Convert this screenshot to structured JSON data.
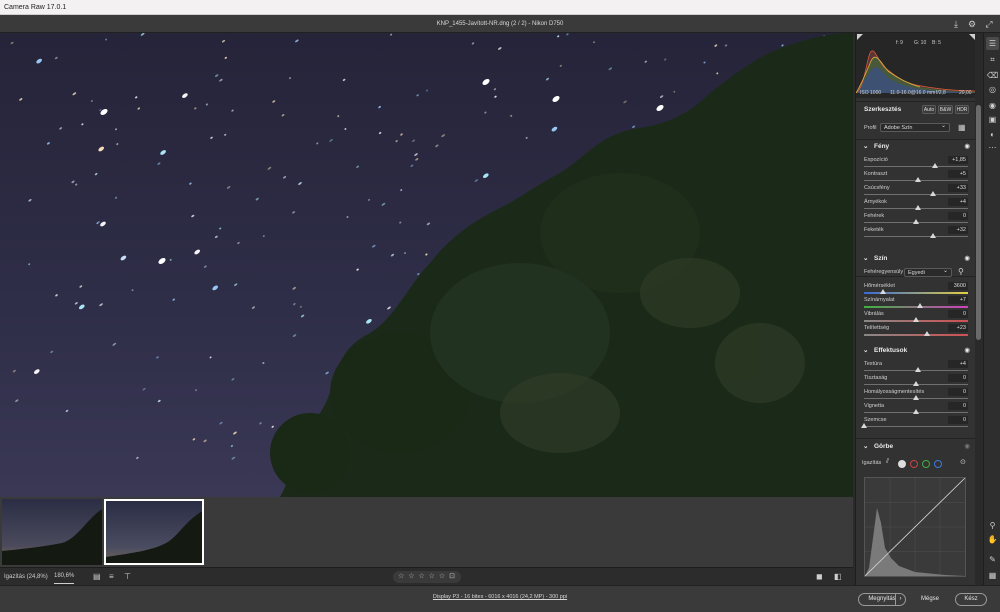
{
  "app": {
    "title": "Camera Raw 17.0.1"
  },
  "document": {
    "title": "KNP_1455-Javított-NR.dng (2 / 2)  -  Nikon D750"
  },
  "histogram": {
    "readouts": [
      "f: 9",
      "G: 10",
      "B: 5"
    ]
  },
  "exif": {
    "iso": "ISO 1000",
    "lens": "11.0-16.0@16.0 mm",
    "aperture": "f/2,8",
    "time": "20,00"
  },
  "edit": {
    "title": "Szerkesztés",
    "modes": [
      "Auto",
      "B&W",
      "HDR"
    ],
    "profile_label": "Profil",
    "profile_value": "Adobe Szín"
  },
  "sections": {
    "light": {
      "title": "Fény",
      "sliders": [
        {
          "label": "Expozíció",
          "value": "+1,85",
          "pos": 0.68
        },
        {
          "label": "Kontraszt",
          "value": "+5",
          "pos": 0.52
        },
        {
          "label": "Csúcsfény",
          "value": "+33",
          "pos": 0.66
        },
        {
          "label": "Árnyékok",
          "value": "+4",
          "pos": 0.52
        },
        {
          "label": "Fehérek",
          "value": "0",
          "pos": 0.5
        },
        {
          "label": "Feketék",
          "value": "+32",
          "pos": 0.66
        }
      ]
    },
    "color": {
      "title": "Szín",
      "wb_label": "Fehéregyensúly",
      "wb_value": "Egyedi",
      "sliders": [
        {
          "label": "Hőmérséklet",
          "value": "3600",
          "pos": 0.18
        },
        {
          "label": "Színárnyalat",
          "value": "+7",
          "pos": 0.54
        },
        {
          "label": "Vibrálás",
          "value": "0",
          "pos": 0.5
        },
        {
          "label": "Telítettség",
          "value": "+23",
          "pos": 0.61
        }
      ]
    },
    "effects": {
      "title": "Effektusok",
      "sliders": [
        {
          "label": "Textúra",
          "value": "+4",
          "pos": 0.52
        },
        {
          "label": "Tisztaság",
          "value": "0",
          "pos": 0.5
        },
        {
          "label": "Homályosságmentesítés",
          "value": "0",
          "pos": 0.5
        },
        {
          "label": "Vignetta",
          "value": "0",
          "pos": 0.5
        },
        {
          "label": "Szemcse",
          "value": "0",
          "pos": 0.0
        }
      ]
    },
    "curve": {
      "title": "Görbe",
      "adjust_label": "Igazítás"
    }
  },
  "statusbar": {
    "fit": "Igazítás (24,8%)",
    "zoom": "180,6%",
    "stars": "☆ ☆ ☆ ☆ ☆"
  },
  "footer": {
    "info": "Display P3 - 16 bites - 6016 x 4016 (24,2 MP) - 300 ppi",
    "open": "Megnyitás",
    "cancel": "Mégse",
    "done": "Kész"
  },
  "colors": {
    "accent_blue": "#2d8ceb",
    "sky": "#2d2c44"
  }
}
